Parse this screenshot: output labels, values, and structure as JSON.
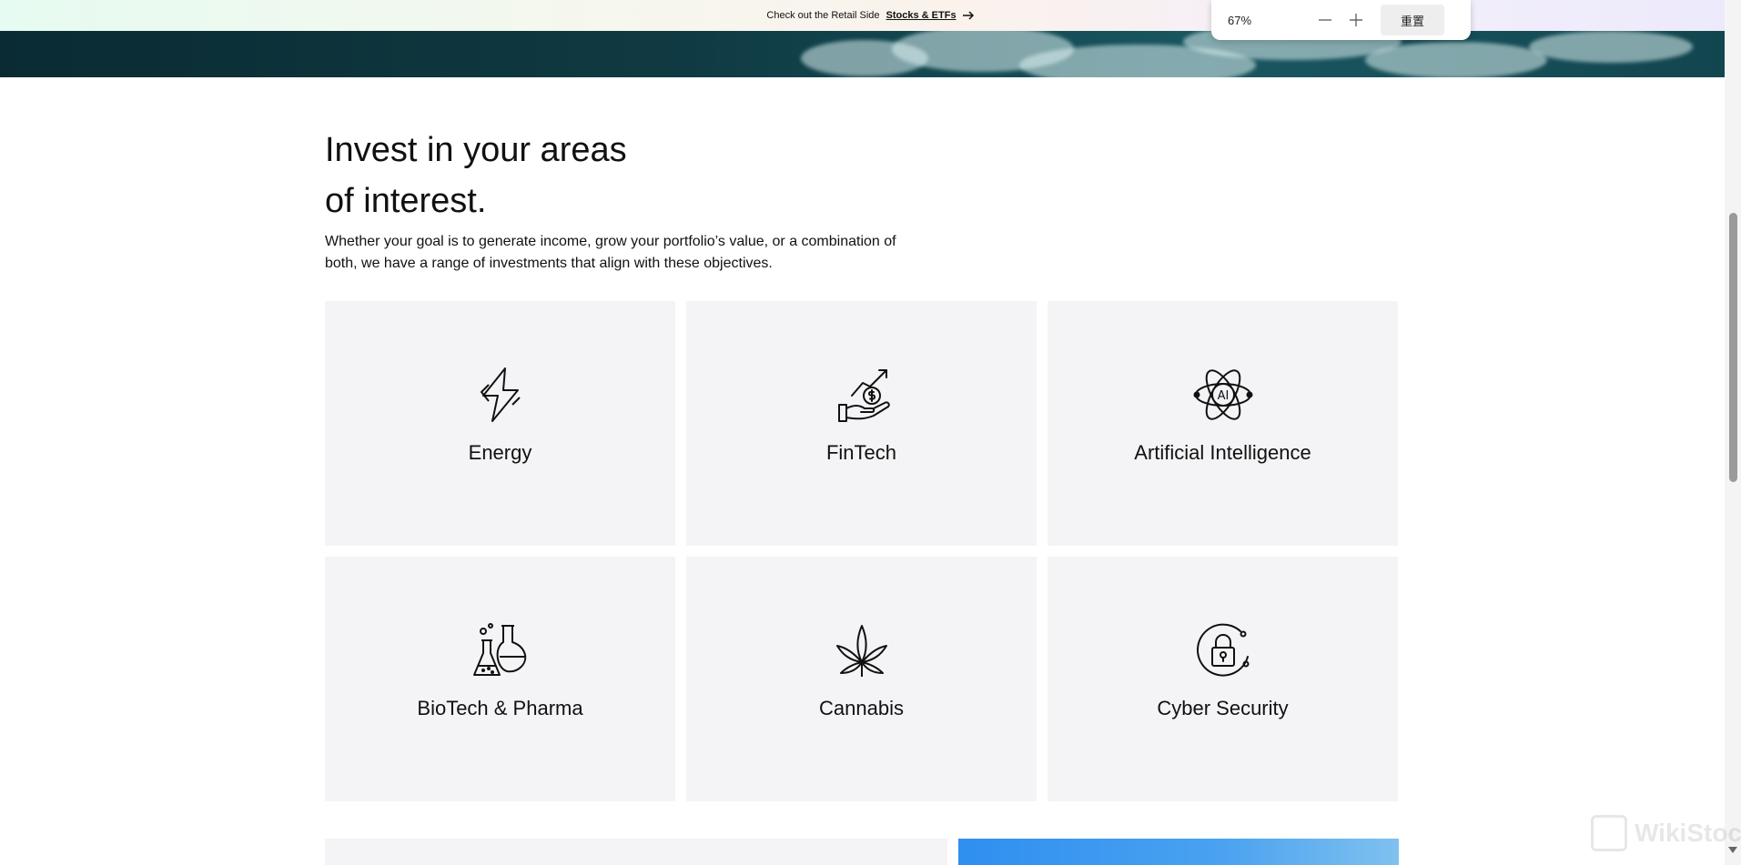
{
  "banner": {
    "text": "Check out the Retail Side",
    "link": "Stocks & ETFs"
  },
  "zoom": {
    "level": "67%",
    "reset": "重置"
  },
  "section": {
    "title_line1": "Invest in your areas",
    "title_line2": "of interest.",
    "description_line1": "Whether your goal is to generate income, grow your portfolio’s value, or a combination of",
    "description_line2": "both, we have a range of investments that align with these objectives."
  },
  "cards": [
    {
      "label": "Energy",
      "icon": "lightning-icon"
    },
    {
      "label": "FinTech",
      "icon": "hand-coin-growth-icon"
    },
    {
      "label": "Artificial Intelligence",
      "icon": "ai-atom-icon"
    },
    {
      "label": "BioTech & Pharma",
      "icon": "flask-icon"
    },
    {
      "label": "Cannabis",
      "icon": "cannabis-leaf-icon"
    },
    {
      "label": "Cyber Security",
      "icon": "padlock-shield-icon"
    }
  ],
  "watermark": "WikiStock"
}
